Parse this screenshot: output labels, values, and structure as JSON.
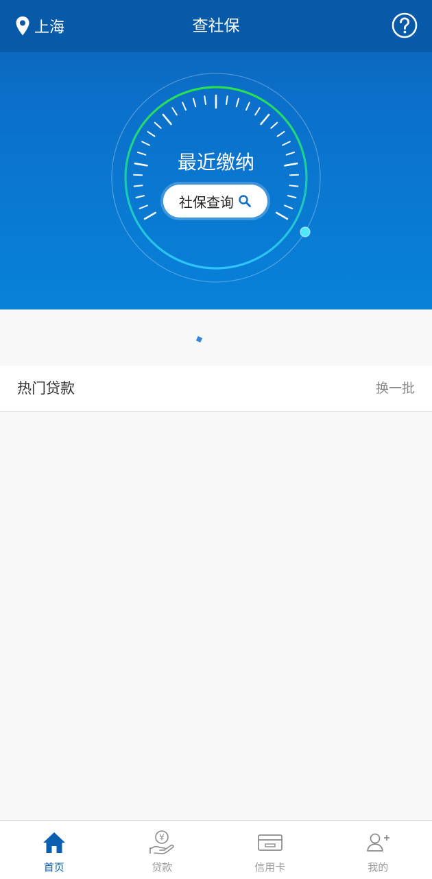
{
  "header": {
    "location": "上海",
    "title": "查社保",
    "help_icon": "question-circle-icon"
  },
  "gauge": {
    "title": "最近缴纳",
    "button_label": "社保查询",
    "accent_color": "#22e05a",
    "indicator_color": "#4fe6ff"
  },
  "section": {
    "title": "热门贷款",
    "action": "换一批"
  },
  "tabs": [
    {
      "label": "首页",
      "icon": "home-icon",
      "active": true
    },
    {
      "label": "贷款",
      "icon": "loan-hand-icon",
      "active": false
    },
    {
      "label": "信用卡",
      "icon": "credit-card-icon",
      "active": false
    },
    {
      "label": "我的",
      "icon": "add-user-icon",
      "active": false
    }
  ],
  "colors": {
    "brand": "#0a5fb0",
    "active_tab": "#0a5fb0",
    "inactive_tab": "#9a9a9a"
  }
}
